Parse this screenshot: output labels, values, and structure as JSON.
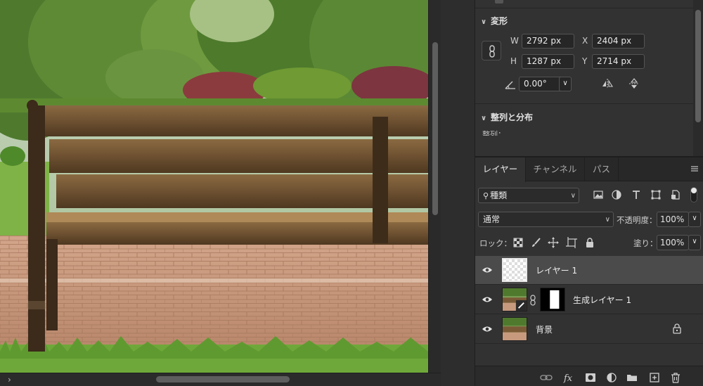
{
  "properties": {
    "transform_title": "変形",
    "w_label": "W",
    "w_value": "2792 px",
    "h_label": "H",
    "h_value": "1287 px",
    "x_label": "X",
    "x_value": "2404 px",
    "y_label": "Y",
    "y_value": "2714 px",
    "angle_value": "0.00°",
    "align_title": "整列と分布",
    "align_sub": "整列："
  },
  "layers_panel": {
    "tabs": [
      "レイヤー",
      "チャンネル",
      "パス"
    ],
    "filter_label": "種類",
    "blend_mode": "通常",
    "opacity_label": "不透明度：",
    "opacity_value": "100%",
    "lock_label": "ロック：",
    "fill_label": "塗り：",
    "fill_value": "100%",
    "layers": [
      {
        "name": "レイヤー 1",
        "selected": true
      },
      {
        "name": "生成レイヤー 1",
        "selected": false
      },
      {
        "name": "背景",
        "selected": false
      }
    ]
  },
  "icons": {
    "canvas_expand": "chevron-right-icon"
  },
  "colors": {
    "panel_bg": "#323232",
    "selected_row": "#4b4b4b",
    "field_bg": "#262626"
  }
}
